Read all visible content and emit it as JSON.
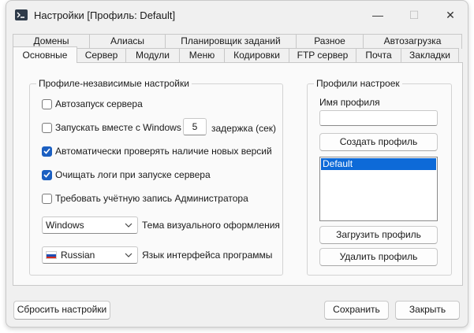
{
  "window": {
    "title": "Настройки [Профиль: Default]",
    "controls": {
      "minimize": "—",
      "maximize": "☐",
      "close": "✕"
    }
  },
  "tabs": {
    "row1": [
      "Домены",
      "Алиасы",
      "Планировщик заданий",
      "Разное",
      "Автозагрузка"
    ],
    "row2": [
      "Основные",
      "Сервер",
      "Модули",
      "Меню",
      "Кодировки",
      "FTP сервер",
      "Почта",
      "Закладки"
    ],
    "active": "Основные"
  },
  "general": {
    "group_title": "Профиле-независимые настройки",
    "options": [
      {
        "label": "Автозапуск сервера",
        "checked": false
      },
      {
        "label": "Запускать вместе с Windows",
        "checked": false
      },
      {
        "label": "Автоматически проверять наличие новых версий",
        "checked": true
      },
      {
        "label": "Очищать логи при запуске сервера",
        "checked": true
      },
      {
        "label": "Требовать учётную запись Администратора",
        "checked": false
      }
    ],
    "delay_value": "5",
    "delay_label": "задержка (сек)",
    "theme_value": "Windows",
    "theme_label": "Тема визуального оформления",
    "language_value": "Russian",
    "language_label": "Язык интерфейса программы"
  },
  "profiles": {
    "group_title": "Профили настроек",
    "name_label": "Имя профиля",
    "name_value": "",
    "create_button": "Создать профиль",
    "list": [
      "Default"
    ],
    "selected": "Default",
    "load_button": "Загрузить профиль",
    "delete_button": "Удалить профиль"
  },
  "footer": {
    "reset_button": "Сбросить настройки",
    "save_button": "Сохранить",
    "close_button": "Закрыть"
  },
  "colors": {
    "accent": "#1b5fc1",
    "selection": "#0d6ad8"
  }
}
